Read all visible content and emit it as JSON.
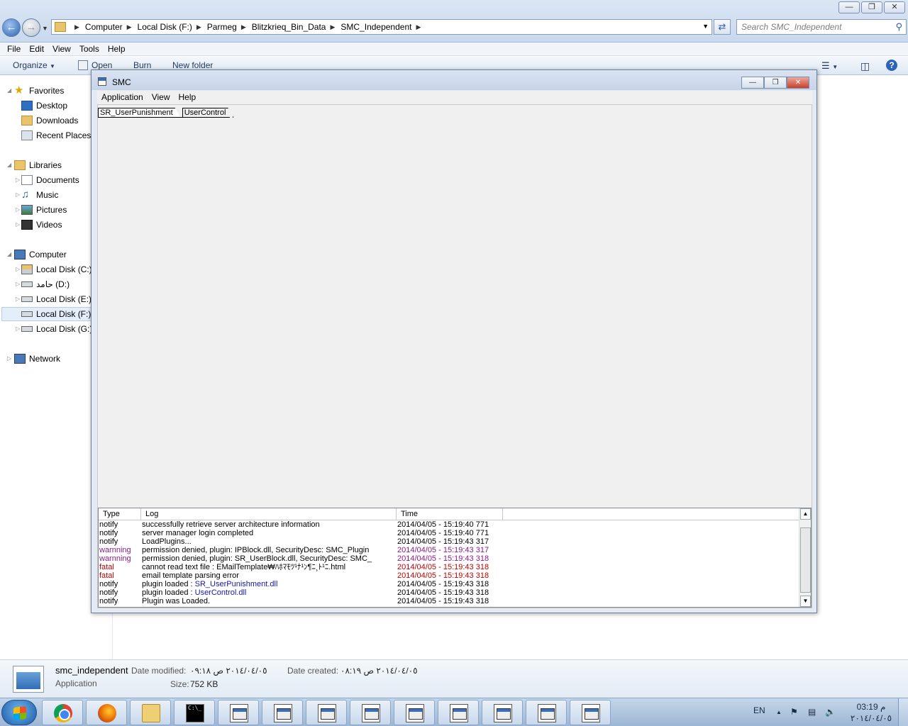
{
  "explorer": {
    "address_crumbs": [
      "Computer",
      "Local Disk (F:)",
      "Parmeg",
      "Blitzkrieq_Bin_Data",
      "SMC_Independent"
    ],
    "search_placeholder": "Search SMC_Independent",
    "menu": [
      "File",
      "Edit",
      "View",
      "Tools",
      "Help"
    ],
    "commands": {
      "organize": "Organize",
      "open": "Open",
      "burn": "Burn",
      "new_folder": "New folder"
    },
    "nav": {
      "favorites": "Favorites",
      "desktop": "Desktop",
      "downloads": "Downloads",
      "recent": "Recent Places",
      "libraries": "Libraries",
      "documents": "Documents",
      "music": "Music",
      "pictures": "Pictures",
      "videos": "Videos",
      "computer": "Computer",
      "disk_c": "Local Disk (C:)",
      "disk_d": "حامد (D:)",
      "disk_e": "Local Disk (E:)",
      "disk_f": "Local Disk (F:)",
      "disk_g": "Local Disk (G:)",
      "network": "Network"
    }
  },
  "details": {
    "name": "smc_independent",
    "type": "Application",
    "modified_label": "Date modified:",
    "modified_value": "٢٠١٤/٠٤/٠٥ ص ٠٩:١٨",
    "created_label": "Date created:",
    "created_value": "٢٠١٤/٠٤/٠٥ ص ٠٨:١٩",
    "size_label": "Size:",
    "size_value": "752 KB"
  },
  "smc": {
    "title": "SMC",
    "menu": [
      "Application",
      "View",
      "Help"
    ],
    "tabs": [
      "SR_UserPunishment",
      "UserControl"
    ],
    "log_headers": [
      "Type",
      "Log",
      "Time"
    ],
    "log_rows": [
      {
        "type": "notify",
        "level": "notify",
        "log": "successfully retrieve server architecture information",
        "link": "",
        "time": "2014/04/05 - 15:19:40 771"
      },
      {
        "type": "notify",
        "level": "notify",
        "log": "server manager login completed",
        "link": "",
        "time": "2014/04/05 - 15:19:40 771"
      },
      {
        "type": "notify",
        "level": "notify",
        "log": "LoadPlugins...",
        "link": "",
        "time": "2014/04/05 - 15:19:43 317"
      },
      {
        "type": "warnning",
        "level": "warning",
        "log": "permission denied, plugin: IPBlock.dll, SecurityDesc: SMC_Plugin",
        "link": "",
        "time": "2014/04/05 - 15:19:43 317"
      },
      {
        "type": "warnning",
        "level": "warning",
        "log": "permission denied, plugin: SR_UserBlock.dll, SecurityDesc: SMC_",
        "link": "",
        "time": "2014/04/05 - 15:19:43 318"
      },
      {
        "type": "fatal",
        "level": "fatal",
        "log": "cannot read text file : EMailTemplate₩ﾊﾎﾏﾓﾂ¹ﾅ¹ﾝ¶ﾆ¸ﾄ¹ﾆ.html",
        "link": "",
        "time": "2014/04/05 - 15:19:43 318"
      },
      {
        "type": "fatal",
        "level": "fatal",
        "log": "email template parsing error",
        "link": "",
        "time": "2014/04/05 - 15:19:43 318"
      },
      {
        "type": "notify",
        "level": "notify",
        "log": "plugin loaded : ",
        "link": "SR_UserPunishment.dll",
        "time": "2014/04/05 - 15:19:43 318"
      },
      {
        "type": "notify",
        "level": "notify",
        "log": "plugin loaded : ",
        "link": "UserControl.dll",
        "time": "2014/04/05 - 15:19:43 318"
      },
      {
        "type": "notify",
        "level": "notify",
        "log": "Plugin was Loaded.",
        "link": "",
        "time": "2014/04/05 - 15:19:43 318"
      }
    ],
    "scroll_thumb_fraction": 0.85
  },
  "taskbar": {
    "lang": "EN",
    "clock_time": "03:19 م",
    "clock_date": "٢٠١٤/٠٤/٠٥"
  },
  "colors": {
    "warning": "#8a1a8a",
    "fatal": "#c00000",
    "link": "#1414b4"
  }
}
